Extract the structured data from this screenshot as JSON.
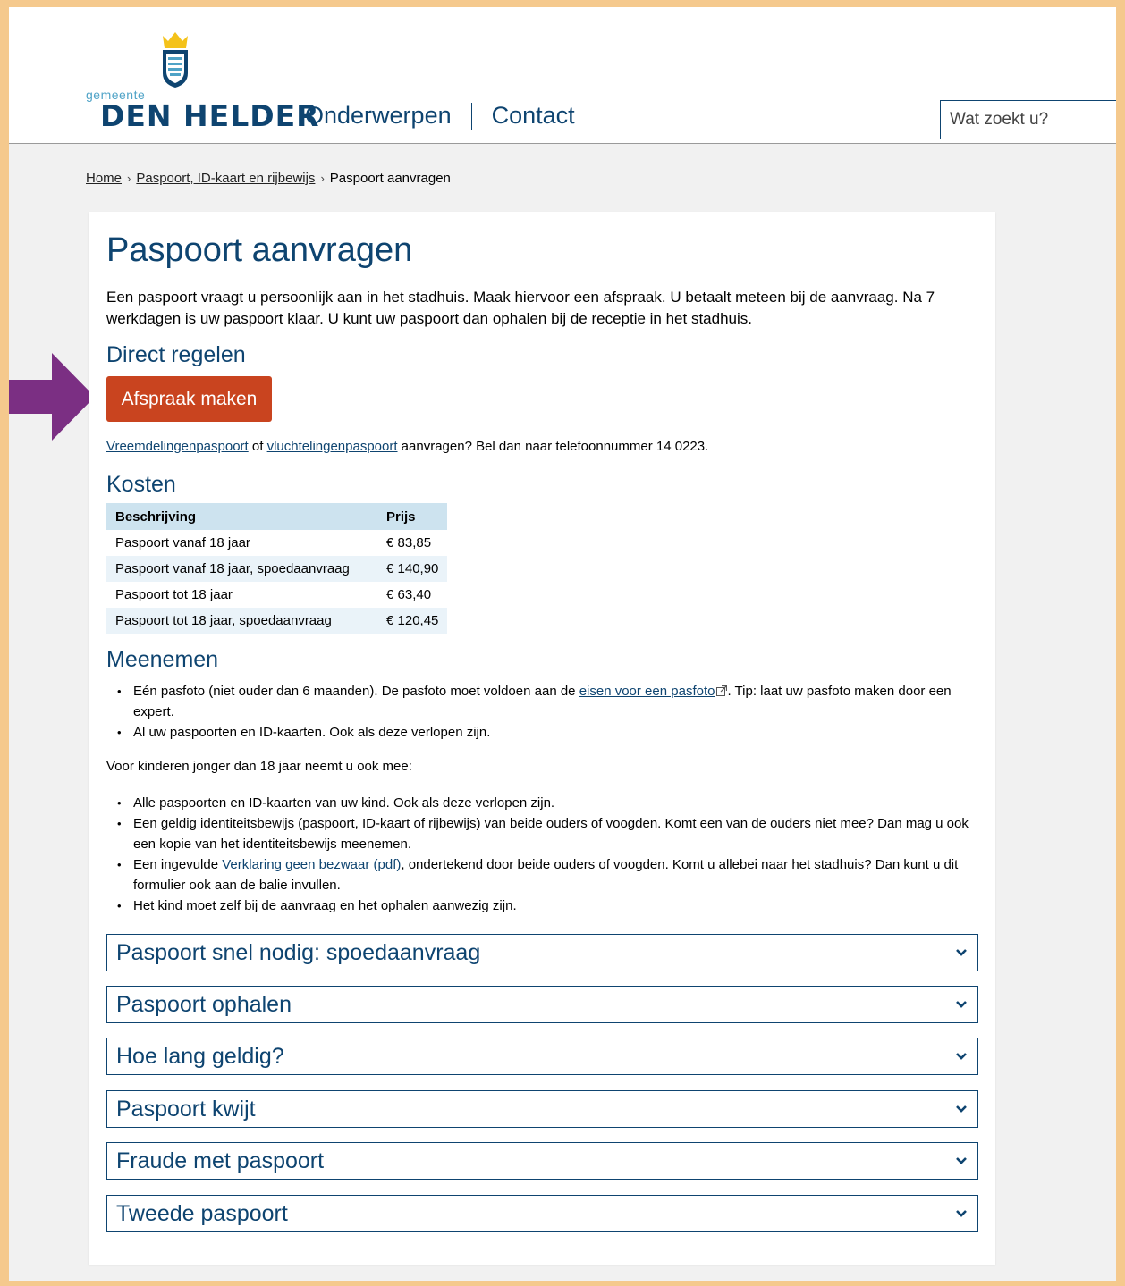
{
  "header": {
    "logo": {
      "small": "gemeente",
      "name": "DEN HELDER"
    },
    "nav": [
      "Onderwerpen",
      "Contact"
    ],
    "search_placeholder": "Wat zoekt u?"
  },
  "breadcrumb": [
    "Home",
    "Paspoort, ID-kaart en rijbewijs",
    "Paspoort aanvragen"
  ],
  "page": {
    "title": "Paspoort aanvragen",
    "intro": "Een paspoort vraagt u persoonlijk aan in het stadhuis. Maak hiervoor een afspraak. U betaalt meteen bij de aanvraag. Na 7 werkdagen is uw paspoort klaar. U kunt uw paspoort dan ophalen bij de receptie in het stadhuis.",
    "direct_heading": "Direct regelen",
    "button_label": "Afspraak maken",
    "button_color": "#c9441f",
    "vreemd": {
      "link1": "Vreemdelingenpaspoort",
      "of": " of ",
      "link2": "vluchtelingenpaspoort",
      "rest": " aanvragen? Bel dan naar telefoonnummer 14 0223."
    },
    "kosten_heading": "Kosten",
    "table": {
      "headers": [
        "Beschrijving",
        "Prijs"
      ],
      "rows": [
        [
          "Paspoort vanaf 18 jaar",
          "€ 83,85"
        ],
        [
          "Paspoort vanaf 18 jaar, spoedaanvraag",
          "€ 140,90"
        ],
        [
          "Paspoort tot 18 jaar",
          "€ 63,40"
        ],
        [
          "Paspoort tot 18 jaar, spoedaanvraag",
          "€ 120,45"
        ]
      ]
    },
    "meenemen_heading": "Meenemen",
    "meenemen_items": {
      "item1_a": "Eén pasfoto (niet ouder dan 6 maanden). De pasfoto moet voldoen aan de ",
      "item1_link": "eisen voor een pasfoto",
      "item1_b": ". Tip: laat uw pasfoto maken door een expert.",
      "item2": "Al uw paspoorten en ID-kaarten. Ook als deze verlopen zijn."
    },
    "kids_label": "Voor kinderen jonger dan 18 jaar neemt u ook mee:",
    "kids_items": {
      "item1": "Alle paspoorten en ID-kaarten van uw kind. Ook als deze verlopen zijn.",
      "item2": "Een geldig identiteitsbewijs (paspoort, ID-kaart of rijbewijs) van beide ouders of voogden. Komt een van de ouders niet mee? Dan mag u ook een kopie van het identiteitsbewijs meenemen.",
      "item3_a": "Een ingevulde ",
      "item3_link": "Verklaring geen bezwaar (pdf)",
      "item3_b": ", ondertekend door beide ouders of voogden. Komt u allebei naar het stadhuis? Dan kunt u dit formulier ook aan de balie invullen.",
      "item4": "Het kind moet zelf bij de aanvraag en het ophalen aanwezig zijn."
    },
    "accordions": [
      "Paspoort snel nodig: spoedaanvraag",
      "Paspoort ophalen",
      "Hoe lang geldig?",
      "Paspoort kwijt",
      "Fraude met paspoort",
      "Tweede paspoort"
    ]
  },
  "colors": {
    "brand": "#0e4470",
    "frame": "#f5c98d",
    "arrow": "#7b2f83",
    "accent_light": "#4fa3c7"
  }
}
